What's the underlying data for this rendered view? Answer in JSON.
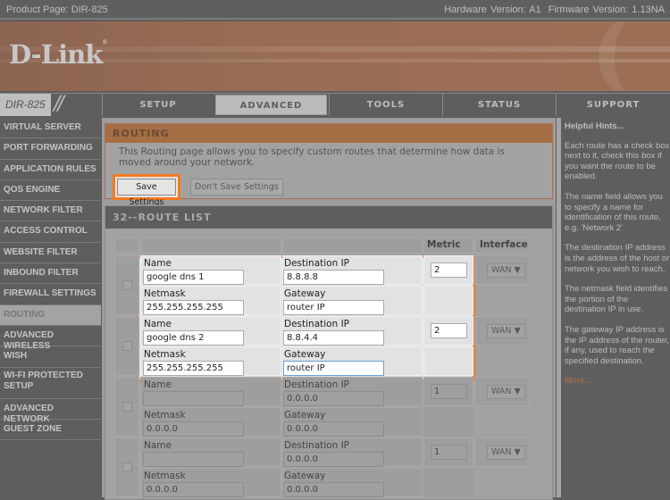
{
  "topbar": {
    "product": "Product Page: DIR-825",
    "hardware": "Hardware Version: A1",
    "firmware": "Firmware Version: 1.13NA"
  },
  "brand": {
    "logo": "D-Link",
    "model": "DIR-825",
    "accent": "#f77a1c"
  },
  "tabs": [
    {
      "label": "SETUP",
      "active": false
    },
    {
      "label": "ADVANCED",
      "active": true
    },
    {
      "label": "TOOLS",
      "active": false
    },
    {
      "label": "STATUS",
      "active": false
    },
    {
      "label": "SUPPORT",
      "active": false
    }
  ],
  "sidebar": [
    {
      "label": "VIRTUAL SERVER"
    },
    {
      "label": "PORT FORWARDING"
    },
    {
      "label": "APPLICATION RULES"
    },
    {
      "label": "QOS ENGINE"
    },
    {
      "label": "NETWORK FILTER"
    },
    {
      "label": "ACCESS CONTROL"
    },
    {
      "label": "WEBSITE FILTER"
    },
    {
      "label": "INBOUND FILTER"
    },
    {
      "label": "FIREWALL SETTINGS"
    },
    {
      "label": "ROUTING",
      "active": true
    },
    {
      "label": "ADVANCED WIRELESS"
    },
    {
      "label": "WISH"
    },
    {
      "label": "WI-FI PROTECTED SETUP"
    },
    {
      "label": "ADVANCED NETWORK"
    },
    {
      "label": "GUEST ZONE"
    }
  ],
  "routing": {
    "title": "ROUTING",
    "description": "This Routing page allows you to specify custom routes that determine how data is moved around your network.",
    "save_label": "Save Settings",
    "dont_save_label": "Don't Save Settings"
  },
  "route_list": {
    "title": "32--ROUTE LIST",
    "headers": {
      "metric": "Metric",
      "interface": "Interface"
    },
    "labels": {
      "name": "Name",
      "destination": "Destination IP",
      "netmask": "Netmask",
      "gateway": "Gateway"
    },
    "routes": [
      {
        "name": "google dns 1",
        "destination": "8.8.8.8",
        "netmask": "255.255.255.255",
        "gateway": "router IP",
        "metric": "2",
        "interface": "WAN",
        "highlighted": true
      },
      {
        "name": "google dns 2",
        "destination": "8.8.4.4",
        "netmask": "255.255.255.255",
        "gateway": "router IP",
        "metric": "2",
        "interface": "WAN",
        "highlighted": true
      },
      {
        "name": "",
        "destination": "0.0.0.0",
        "netmask": "0.0.0.0",
        "gateway": "0.0.0.0",
        "metric": "1",
        "interface": "WAN",
        "highlighted": false
      },
      {
        "name": "",
        "destination": "0.0.0.0",
        "netmask": "0.0.0.0",
        "gateway": "0.0.0.0",
        "metric": "1",
        "interface": "WAN",
        "highlighted": false
      }
    ]
  },
  "hints": {
    "title": "Helpful Hints...",
    "paragraphs": [
      "Each route has a check box next to it, check this box if you want the route to be enabled.",
      "The name field allows you to specify a name for identification of this route, e.g. 'Network 2'",
      "The destination IP address is the address of the host or network you wish to reach.",
      "The netmask field identifies the portion of the destination IP in use.",
      "The gateway IP address is the IP address of the router, if any, used to reach the specified destination."
    ],
    "more": "More..."
  }
}
